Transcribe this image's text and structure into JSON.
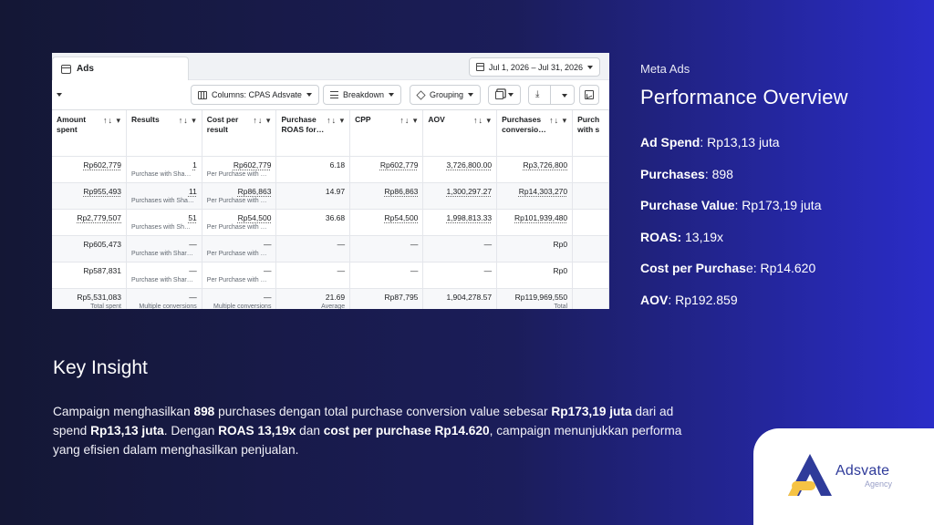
{
  "screenshot": {
    "tab_label": "Ads",
    "date_range": "Jul 1, 2026 – Jul 31, 2026",
    "toolbar": {
      "columns_label": "Columns: CPAS Adsvate",
      "breakdown_label": "Breakdown",
      "grouping_label": "Grouping"
    },
    "columns": [
      {
        "label": "Amount spent",
        "icons": "↑↓ ▾"
      },
      {
        "label": "Results",
        "icons": "↑↓ ▾"
      },
      {
        "label": "Cost per result",
        "icons": "↑↓ ▾"
      },
      {
        "label": "Purchase ROAS for…",
        "icons": "↑↓ ▾"
      },
      {
        "label": "CPP",
        "icons": "↑↓ ▾"
      },
      {
        "label": "AOV",
        "icons": "↑↓ ▾"
      },
      {
        "label": "Purchases conversio…",
        "icons": "↑↓ ▾"
      },
      {
        "label": "Purch with s",
        "icons": ""
      }
    ],
    "rows": [
      {
        "spent": "Rp602,779",
        "results": "1",
        "results_sub": "Purchase with Sha…",
        "cpr": "Rp602,779",
        "cpr_sub": "Per Purchase with …",
        "roas": "6.18",
        "cpp": "Rp602,779",
        "aov": "3,726,800.00",
        "conv": "Rp3,726,800",
        "conv_sub": ""
      },
      {
        "spent": "Rp955,493",
        "results": "11",
        "results_sub": "Purchases with Sha…",
        "cpr": "Rp86,863",
        "cpr_sub": "Per Purchase with …",
        "roas": "14.97",
        "cpp": "Rp86,863",
        "aov": "1,300,297.27",
        "conv": "Rp14,303,270",
        "conv_sub": ""
      },
      {
        "spent": "Rp2,779,507",
        "results": "51",
        "results_sub": "Purchases with Sh…",
        "cpr": "Rp54,500",
        "cpr_sub": "Per Purchase with …",
        "roas": "36.68",
        "cpp": "Rp54,500",
        "aov": "1,998,813.33",
        "conv": "Rp101,939,480",
        "conv_sub": ""
      },
      {
        "spent": "Rp605,473",
        "results": "—",
        "results_sub": "Purchase with Shar…",
        "cpr": "—",
        "cpr_sub": "Per Purchase with …",
        "roas": "—",
        "cpp": "—",
        "aov": "—",
        "conv": "Rp0",
        "conv_sub": ""
      },
      {
        "spent": "Rp587,831",
        "results": "—",
        "results_sub": "Purchase with Shar…",
        "cpr": "—",
        "cpr_sub": "Per Purchase with …",
        "roas": "—",
        "cpp": "—",
        "aov": "—",
        "conv": "Rp0",
        "conv_sub": ""
      }
    ],
    "total_row": {
      "spent": "Rp5,531,083",
      "spent_sub": "Total spent",
      "results": "—",
      "results_sub": "Multiple conversions",
      "cpr": "—",
      "cpr_sub": "Multiple conversions",
      "roas": "21.69",
      "roas_sub": "Average",
      "cpp": "Rp87,795",
      "aov": "1,904,278.57",
      "conv": "Rp119,969,550",
      "conv_sub": "Total"
    }
  },
  "side": {
    "kicker": "Meta Ads",
    "title": "Performance Overview",
    "metrics": [
      {
        "label": "Ad Spend",
        "sep": ": ",
        "value": "Rp13,13 juta"
      },
      {
        "label": "Purchases",
        "sep": ": ",
        "value": "898"
      },
      {
        "label": "Purchase Value",
        "sep": ": ",
        "value": "Rp173,19 juta"
      },
      {
        "label": "ROAS:",
        "sep": " ",
        "value": "13,19x"
      },
      {
        "label": "Cost per Purchas",
        "sep": "e: ",
        "value": "Rp14.620"
      },
      {
        "label": "AOV",
        "sep": ": ",
        "value": "Rp192.859"
      }
    ]
  },
  "insight": {
    "title": "Key Insight",
    "parts": [
      {
        "t": "Campaign menghasilkan ",
        "b": false
      },
      {
        "t": "898",
        "b": true
      },
      {
        "t": " purchases dengan total purchase conversion value sebesar ",
        "b": false
      },
      {
        "t": "Rp173,19 juta",
        "b": true
      },
      {
        "t": " dari ad spend ",
        "b": false
      },
      {
        "t": "Rp13,13 juta",
        "b": true
      },
      {
        "t": ". Dengan ",
        "b": false
      },
      {
        "t": "ROAS 13,19x",
        "b": true
      },
      {
        "t": " dan ",
        "b": false
      },
      {
        "t": "cost per purchase Rp14.620",
        "b": true
      },
      {
        "t": ", campaign menunjukkan performa yang efisien dalam menghasilkan penjualan.",
        "b": false
      }
    ]
  },
  "logo": {
    "name": "Adsvate",
    "sub": "Agency",
    "colors": {
      "blue": "#2f3b9a",
      "yellow": "#f6c344"
    }
  }
}
